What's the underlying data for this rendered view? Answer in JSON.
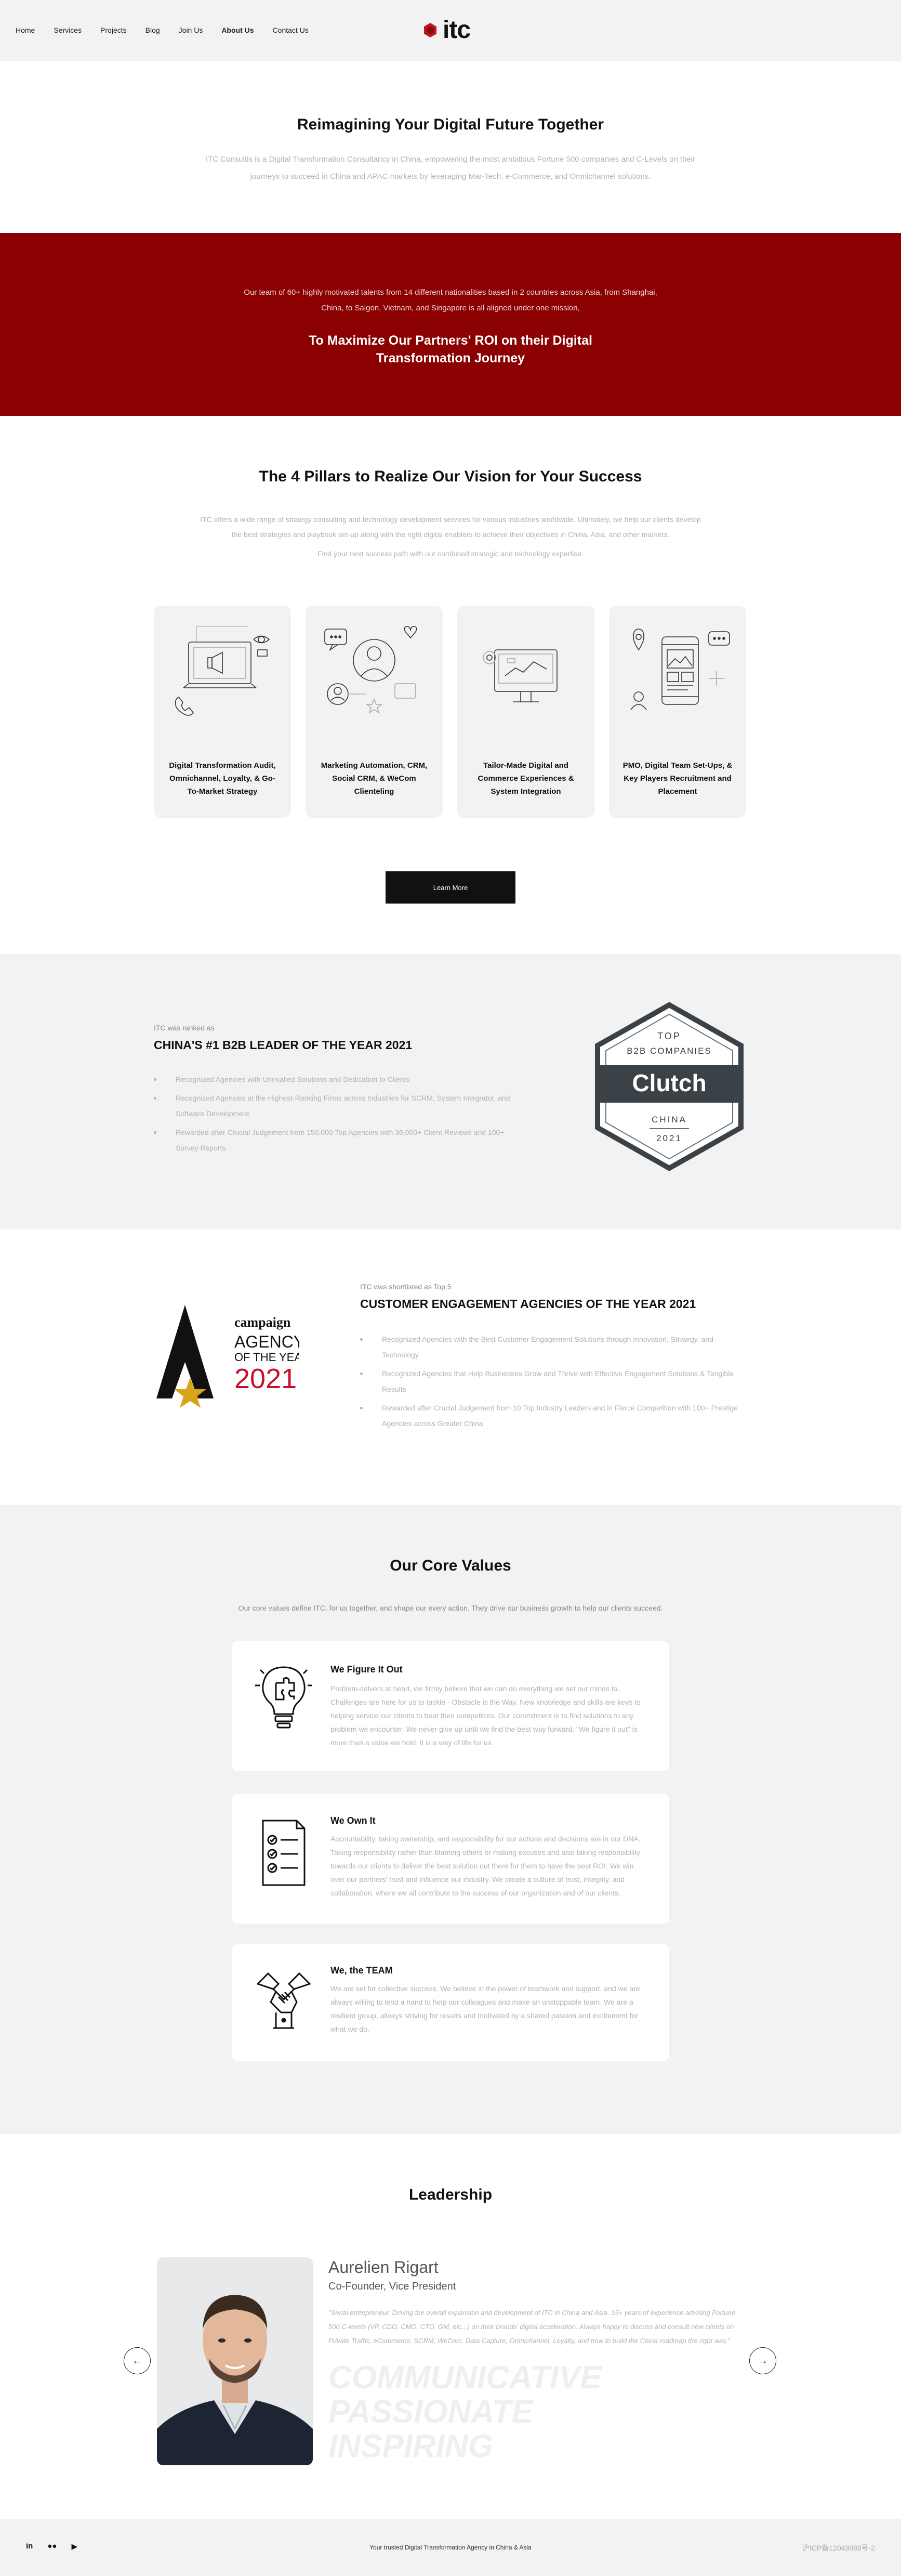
{
  "nav": {
    "links": [
      "Home",
      "Services",
      "Projects",
      "Blog",
      "Join Us",
      "About Us",
      "Contact Us"
    ],
    "active": "About Us",
    "logo_text": "itc"
  },
  "hero": {
    "title": "Reimagining Your Digital Future Together",
    "text": "ITC Consultis is a Digital Transformation Consultancy in China, empowering the most ambitious Fortune 500 companies and C-Levels on their journeys to succeed in China and APAC markets by leveraging Mar-Tech, e-Commerce, and Omnichannel solutions."
  },
  "band": {
    "text": "Our team of 60+ highly motivated talents from 14 different nationalities based in 2 countries across Asia, from Shanghai, China, to Saigon, Vietnam, and Singapore is all aligned under one mission,",
    "headline": "To Maximize Our Partners' ROI on their Digital Transformation Journey",
    "color": "#8b0000"
  },
  "pillars": {
    "title": "The 4 Pillars to Realize Our Vision for Your Success",
    "intro": "ITC offers a wide range of strategy consulting and technology development services for various industries worldwide. Ultimately, we help our clients develop the best strategies and playbook set-up along with the right digital enablers to achieve their objectives in China, Asia, and other markets.",
    "intro2": "Find your next success path with our combined strategic and technology expertise.",
    "cards": [
      {
        "label": "Digital Transformation Audit, Omnichannel, Loyalty, & Go-To-Market Strategy",
        "icon": "marketing-strategy-icon"
      },
      {
        "label": "Marketing Automation, CRM, Social CRM, & WeCom Clienteling",
        "icon": "crm-icon"
      },
      {
        "label": "Tailor-Made Digital and Commerce Experiences & System Integration",
        "icon": "commerce-icon"
      },
      {
        "label": "PMO, Digital Team Set-Ups, & Key Players Recruitment and Placement",
        "icon": "mobile-app-icon"
      }
    ],
    "button": "Learn More"
  },
  "b2b": {
    "small": "ITC was ranked as",
    "title": "CHINA'S #1 B2B LEADER OF THE YEAR 2021",
    "items": [
      "Recognized Agencies with Unrivalled Solutions and Dedication to Clients",
      "Recognized Agencies at the Highest-Ranking Firms across Industries for SCRM, System Integrator, and Software Development",
      "Rewarded after Crucial Judgement from 150,000 Top Agencies with 36,000+ Client Reviews and 100+ Survey Reports"
    ],
    "badge": {
      "top": "TOP",
      "line": "B2B COMPANIES",
      "brand": "Clutch",
      "country": "CHINA",
      "year": "2021"
    }
  },
  "cust": {
    "small": "ITC was shortlisted as Top 5",
    "title": "CUSTOMER ENGAGEMENT AGENCIES OF THE YEAR 2021",
    "items": [
      "Recognized Agencies with the Best Customer Engagement Solutions through Innovation, Strategy, and Technology",
      "Recognized Agencies that Help Businesses Grow and Thrive with Effective Engagement Solutions & Tangible Results",
      "Rewarded after Crucial Judgement from 10 Top Industry Leaders and in Fierce Competition with 100+ Prestige Agencies across Greater China"
    ],
    "award": {
      "brand": "campaign",
      "line1": "AGENCY",
      "line2": "OF THE YEAR",
      "year": "2021"
    }
  },
  "core": {
    "title": "Our Core Values",
    "intro": "Our core values define ITC, for us together, and shape our every action. They drive our business growth to help our clients succeed.",
    "values": [
      {
        "title": "We Figure It Out",
        "text": "Problem-solvers at heart, we firmly believe that we can do everything we set our minds to. Challenges are here for us to tackle - Obstacle is the Way. New knowledge and skills are keys to helping service our clients to beat their competitors. Our commitment is to find solutions to any problem we encounter. We never give up until we find the best way forward. \"We figure it out\" is more than a value we hold; it is a way of life for us."
      },
      {
        "title": "We Own It",
        "text": "Accountability, taking ownership, and responsibility for our actions and decisions are in our DNA. Taking responsibility rather than blaming others or making excuses and also taking responsibility towards our clients to deliver the best solution out there for them to have the best ROI. We win over our partners' trust and influence our industry. We create a culture of trust, integrity, and collaboration, where we all contribute to the success of our organization and of our clients."
      },
      {
        "title": "We, the TEAM",
        "text": "We are set for collective success. We believe in the power of teamwork and support, and we are always willing to lend a hand to help our colleagues and make an unstoppable team. We are a resilient group, always striving for results and motivated by a shared passion and excitement for what we do."
      }
    ]
  },
  "leadership": {
    "title": "Leadership",
    "name": "Aurelien Rigart",
    "role": "Co-Founder, Vice President",
    "bio": "\"Serial entrepreneur. Driving the overall expansion and development of ITC in China and Asia. 15+ years of experience advising Fortune 500 C-levels (VP, CDO, CMO, CTO, GM, etc...) on their brands' digital acceleration. Always happy to discuss and consult new clients on Private Traffic, eCommerce, SCRM, WeCom, Data Capture, Omnichannel, Loyalty, and how to build the China roadmap the right way.\"",
    "traits": [
      "COMMUNICATIVE",
      "PASSIONATE",
      "INSPIRING"
    ]
  },
  "footer": {
    "tagline": "Your trusted Digital Transformation Agency in China & Asia",
    "icp": "沪ICP备12043089号-2"
  }
}
